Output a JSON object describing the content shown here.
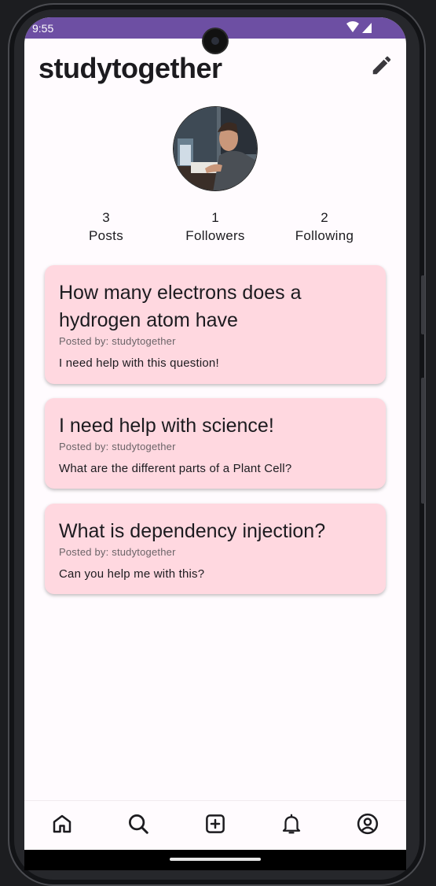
{
  "status_bar": {
    "time": "9:55"
  },
  "header": {
    "title": "studytogether"
  },
  "profile": {
    "stats": [
      {
        "value": "3",
        "label": "Posts"
      },
      {
        "value": "1",
        "label": "Followers"
      },
      {
        "value": "2",
        "label": "Following"
      }
    ]
  },
  "posts": [
    {
      "title": "How many electrons does a hydrogen atom have",
      "posted_by": "Posted by: studytogether",
      "body": "I need help with this question!"
    },
    {
      "title": "I need help with science!",
      "posted_by": "Posted by: studytogether",
      "body": "What are the different parts of a Plant Cell?"
    },
    {
      "title": "What is dependency injection?",
      "posted_by": "Posted by: studytogether",
      "body": "Can you help me with this?"
    }
  ],
  "bottom_nav": {
    "items": [
      {
        "icon": "home-icon"
      },
      {
        "icon": "search-icon"
      },
      {
        "icon": "add-box-icon"
      },
      {
        "icon": "notifications-icon"
      },
      {
        "icon": "account-circle-icon"
      }
    ]
  },
  "colors": {
    "status_bar": "#6d4fa3",
    "card": "#ffd8e0",
    "background": "#fffbfe"
  }
}
